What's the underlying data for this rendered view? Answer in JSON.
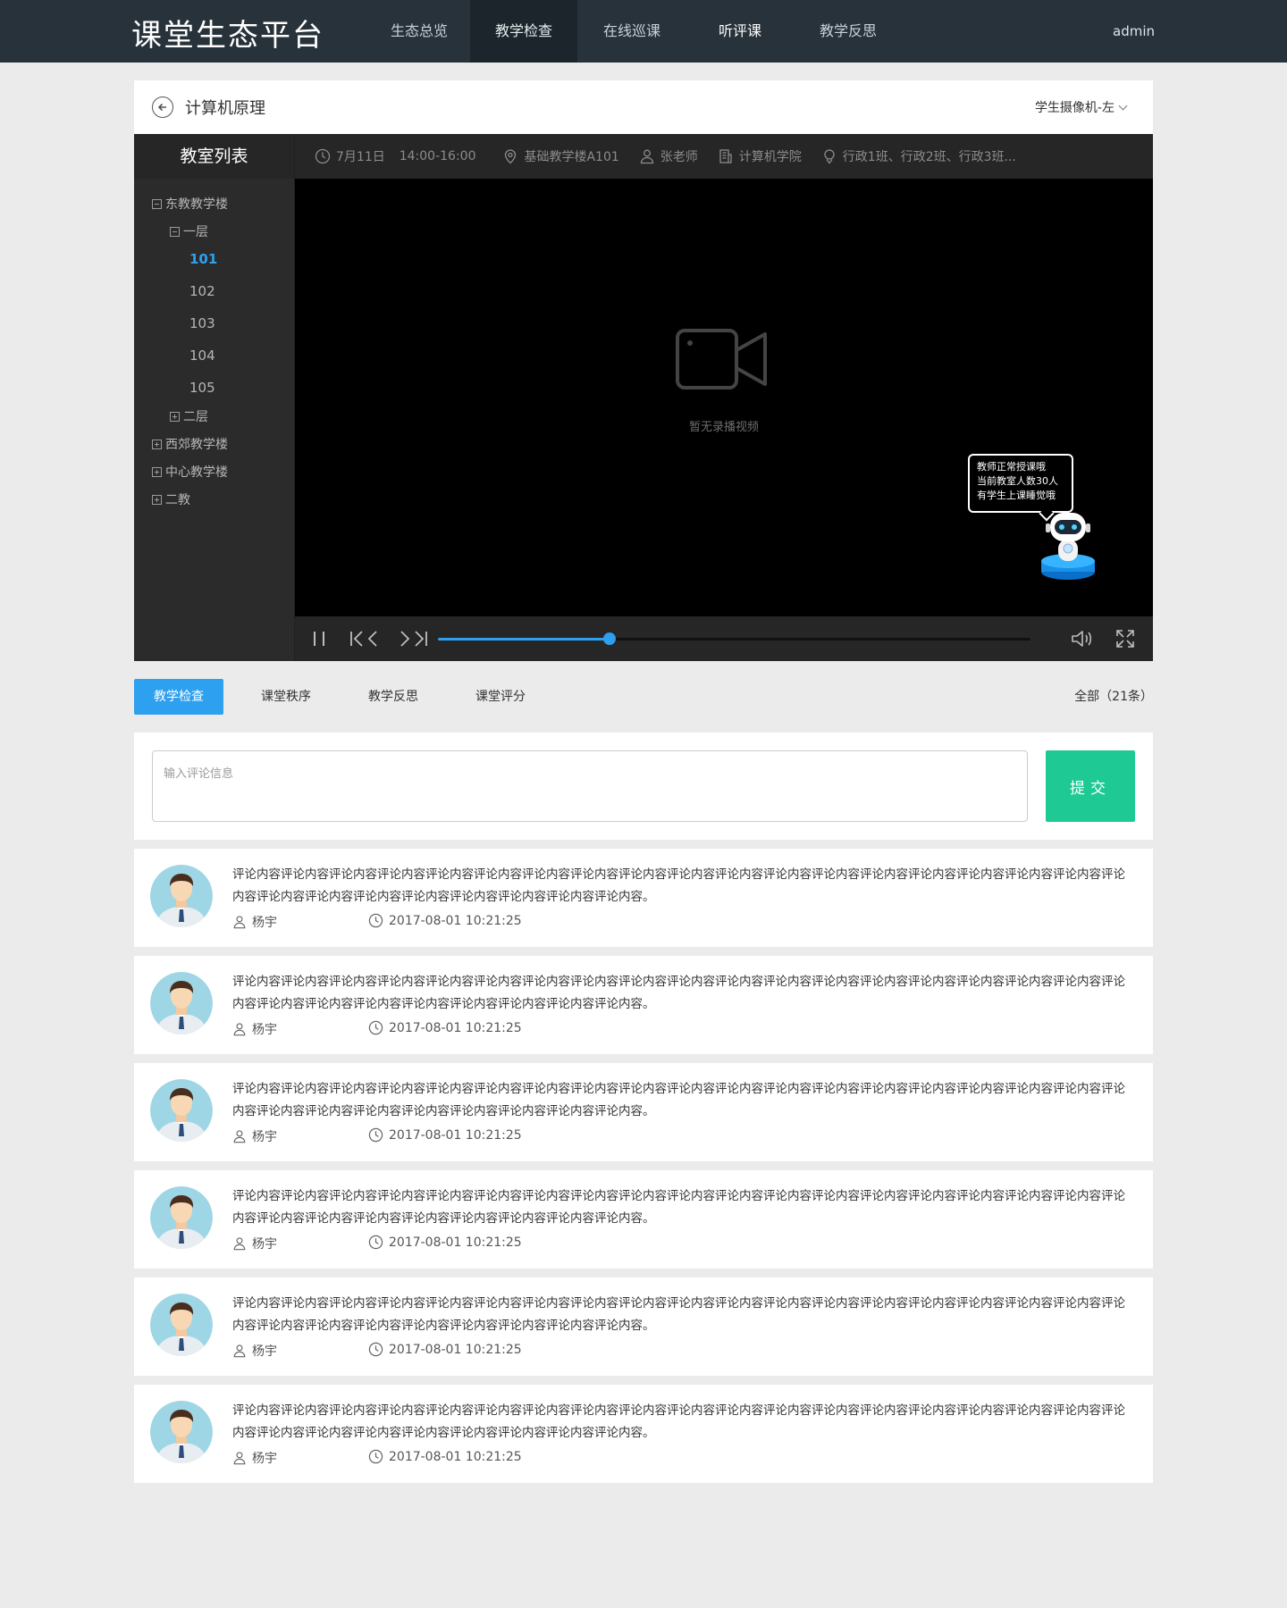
{
  "header": {
    "logo": "课堂生态平台",
    "nav": [
      {
        "label": "生态总览",
        "state": "normal"
      },
      {
        "label": "教学检查",
        "state": "active"
      },
      {
        "label": "在线巡课",
        "state": "normal"
      },
      {
        "label": "听评课",
        "state": "bright"
      },
      {
        "label": "教学反思",
        "state": "normal"
      }
    ],
    "user": "admin"
  },
  "course": {
    "title": "计算机原理",
    "camera": "学生摄像机-左"
  },
  "classroom_tree": {
    "title": "教室列表",
    "buildings": [
      {
        "label": "东教教学楼",
        "expanded": true
      },
      {
        "label": "西郊教学楼",
        "expanded": false
      },
      {
        "label": "中心教学楼",
        "expanded": false
      },
      {
        "label": "二教",
        "expanded": false
      }
    ],
    "floors": [
      {
        "label": "一层",
        "expanded": true
      },
      {
        "label": "二层",
        "expanded": false
      }
    ],
    "rooms": [
      "101",
      "102",
      "103",
      "104",
      "105"
    ],
    "selected_room": "101"
  },
  "lesson_info": {
    "date": "7月11日",
    "time": "14:00-16:00",
    "location": "基础教学楼A101",
    "teacher": "张老师",
    "college": "计算机学院",
    "classes": "行政1班、行政2班、行政3班..."
  },
  "video": {
    "empty_text": "暂无录播视频",
    "bubble_lines": [
      "教师正常授课哦",
      "当前教室人数30人",
      "有学生上课睡觉哦"
    ],
    "progress": 0.29
  },
  "tabs": {
    "items": [
      "教学检查",
      "课堂秩序",
      "教学反思",
      "课堂评分"
    ],
    "active_index": 0,
    "total": "全部（21条）"
  },
  "comment_form": {
    "placeholder": "输入评论信息",
    "submit_label": "提交"
  },
  "comments": [
    {
      "text": "评论内容评论内容评论内容评论内容评论内容评论内容评论内容评论内容评论内容评论内容评论内容评论内容评论内容评论内容评论内容评论内容评论内容评论内容评论内容评论内容评论内容评论内容评论内容评论内容评论内容评论内容评论内容。",
      "author": "杨宇",
      "time": "2017-08-01 10:21:25"
    },
    {
      "text": "评论内容评论内容评论内容评论内容评论内容评论内容评论内容评论内容评论内容评论内容评论内容评论内容评论内容评论内容评论内容评论内容评论内容评论内容评论内容评论内容评论内容评论内容评论内容评论内容评论内容评论内容评论内容。",
      "author": "杨宇",
      "time": "2017-08-01 10:21:25"
    },
    {
      "text": "评论内容评论内容评论内容评论内容评论内容评论内容评论内容评论内容评论内容评论内容评论内容评论内容评论内容评论内容评论内容评论内容评论内容评论内容评论内容评论内容评论内容评论内容评论内容评论内容评论内容评论内容评论内容。",
      "author": "杨宇",
      "time": "2017-08-01 10:21:25"
    },
    {
      "text": "评论内容评论内容评论内容评论内容评论内容评论内容评论内容评论内容评论内容评论内容评论内容评论内容评论内容评论内容评论内容评论内容评论内容评论内容评论内容评论内容评论内容评论内容评论内容评论内容评论内容评论内容评论内容。",
      "author": "杨宇",
      "time": "2017-08-01 10:21:25"
    },
    {
      "text": "评论内容评论内容评论内容评论内容评论内容评论内容评论内容评论内容评论内容评论内容评论内容评论内容评论内容评论内容评论内容评论内容评论内容评论内容评论内容评论内容评论内容评论内容评论内容评论内容评论内容评论内容评论内容。",
      "author": "杨宇",
      "time": "2017-08-01 10:21:25"
    },
    {
      "text": "评论内容评论内容评论内容评论内容评论内容评论内容评论内容评论内容评论内容评论内容评论内容评论内容评论内容评论内容评论内容评论内容评论内容评论内容评论内容评论内容评论内容评论内容评论内容评论内容评论内容评论内容评论内容。",
      "author": "杨宇",
      "time": "2017-08-01 10:21:25"
    }
  ],
  "colors": {
    "nav_bg": "#27323a",
    "accent_blue": "#2ea0f0",
    "submit_green": "#1fc993"
  }
}
